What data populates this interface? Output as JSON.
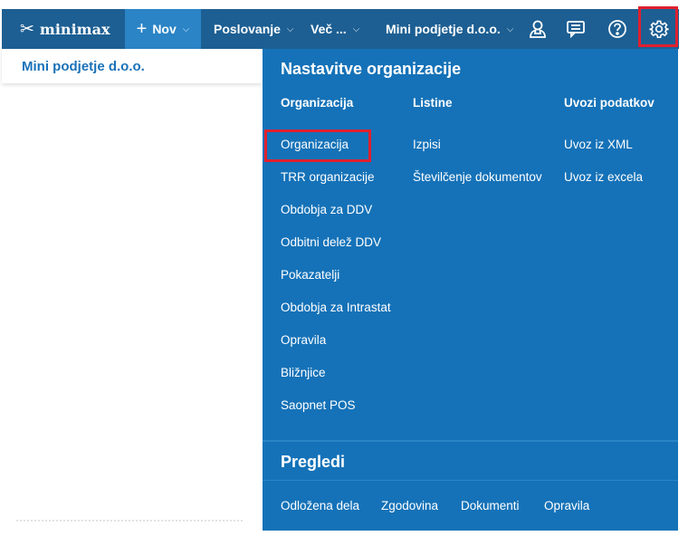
{
  "topbar": {
    "logo": "minimax",
    "new_label": "Nov",
    "business_label": "Poslovanje",
    "more_label": "Več ...",
    "org_label": "Mini podjetje d.o.o.",
    "icons": [
      "user-icon",
      "message-icon",
      "help-icon",
      "gear-icon"
    ]
  },
  "left": {
    "title": "Mini podjetje d.o.o."
  },
  "panel": {
    "title": "Nastavitve organizacije",
    "columns": [
      {
        "heading": "Organizacija",
        "items": [
          "Organizacija",
          "TRR organizacije",
          "Obdobja za DDV",
          "Odbitni delež DDV",
          "Pokazatelji",
          "Obdobja za Intrastat",
          "Opravila",
          "Bližnjice",
          "Saopnet POS"
        ]
      },
      {
        "heading": "Listine",
        "items": [
          "Izpisi",
          "Številčenje dokumentov"
        ]
      },
      {
        "heading": "Uvozi podatkov",
        "items": [
          "Uvoz iz XML",
          "Uvoz iz excela"
        ]
      }
    ],
    "pregledi": {
      "title": "Pregledi",
      "items": [
        "Odložena dela",
        "Zgodovina",
        "Dokumenti",
        "Opravila"
      ]
    }
  },
  "colors": {
    "topbar": "#1d5f93",
    "active": "#2a84c6",
    "panel": "#1572b8",
    "highlight": "#e0202e",
    "link": "#1a72b9"
  }
}
